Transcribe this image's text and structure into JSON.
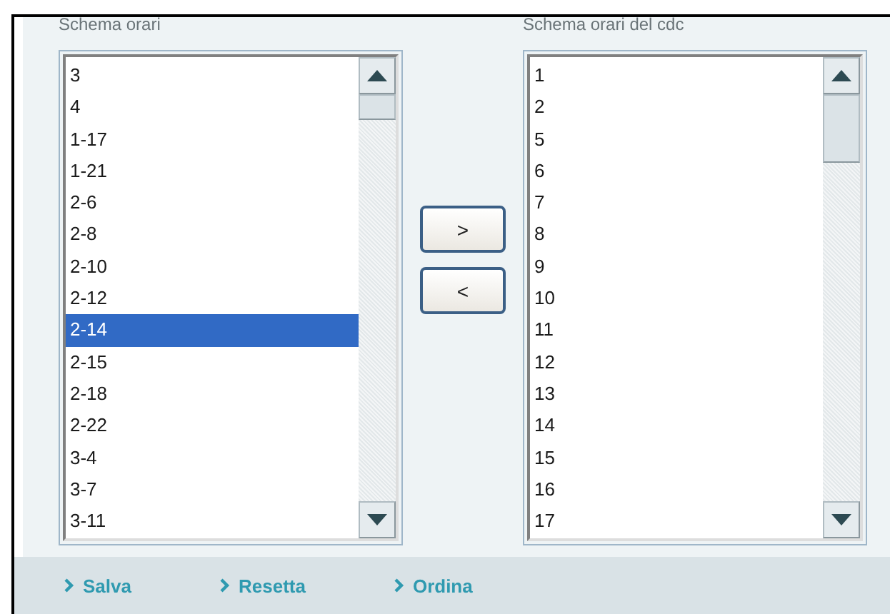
{
  "lists": [
    {
      "label": "Schema orari",
      "items": [
        {
          "text": "3",
          "selected": false
        },
        {
          "text": "4",
          "selected": false
        },
        {
          "text": "1-17",
          "selected": false
        },
        {
          "text": "1-21",
          "selected": false
        },
        {
          "text": "2-6",
          "selected": false
        },
        {
          "text": "2-8",
          "selected": false
        },
        {
          "text": "2-10",
          "selected": false
        },
        {
          "text": "2-12",
          "selected": false
        },
        {
          "text": "2-14",
          "selected": true
        },
        {
          "text": "2-15",
          "selected": false
        },
        {
          "text": "2-18",
          "selected": false
        },
        {
          "text": "2-22",
          "selected": false
        },
        {
          "text": "3-4",
          "selected": false
        },
        {
          "text": "3-7",
          "selected": false
        },
        {
          "text": "3-11",
          "selected": false
        }
      ]
    },
    {
      "label": "Schema orari del cdc",
      "items": [
        {
          "text": "1",
          "selected": false
        },
        {
          "text": "2",
          "selected": false
        },
        {
          "text": "5",
          "selected": false
        },
        {
          "text": "6",
          "selected": false
        },
        {
          "text": "7",
          "selected": false
        },
        {
          "text": "8",
          "selected": false
        },
        {
          "text": "9",
          "selected": false
        },
        {
          "text": "10",
          "selected": false
        },
        {
          "text": "11",
          "selected": false
        },
        {
          "text": "12",
          "selected": false
        },
        {
          "text": "13",
          "selected": false
        },
        {
          "text": "14",
          "selected": false
        },
        {
          "text": "15",
          "selected": false
        },
        {
          "text": "16",
          "selected": false
        },
        {
          "text": "17",
          "selected": false
        }
      ]
    }
  ],
  "move_buttons": [
    ">",
    "<"
  ],
  "footer_links": [
    "Salva",
    "Resetta",
    "Ordina"
  ]
}
